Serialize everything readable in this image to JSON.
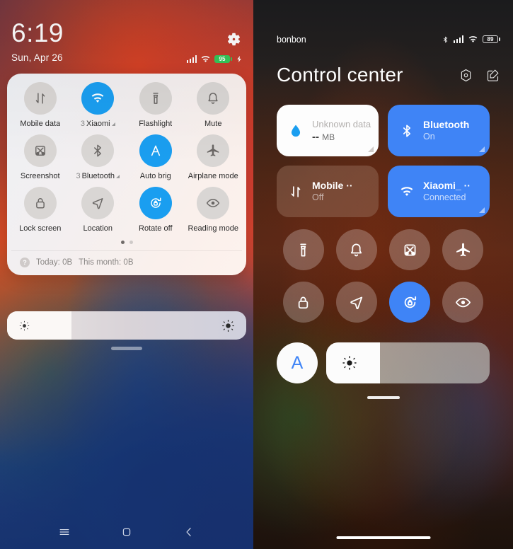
{
  "left": {
    "status": {
      "time": "6:19",
      "date": "Sun, Apr 26",
      "gear_icon": "gear-icon",
      "signal_icon": "signal-bars-icon",
      "wifi_icon": "wifi-icon",
      "battery_level": "95",
      "charging_icon": "charging-bolt-icon"
    },
    "quick_settings": {
      "tiles": [
        {
          "label": "Mobile data",
          "icon": "mobile-data-icon",
          "active": false,
          "badge": "",
          "has_arrow": false
        },
        {
          "label": "Xiaomi",
          "icon": "wifi-icon",
          "active": true,
          "badge": "3",
          "has_arrow": true
        },
        {
          "label": "Flashlight",
          "icon": "flashlight-icon",
          "active": false,
          "badge": "",
          "has_arrow": false
        },
        {
          "label": "Mute",
          "icon": "bell-icon",
          "active": false,
          "badge": "",
          "has_arrow": false
        },
        {
          "label": "Screenshot",
          "icon": "screenshot-icon",
          "active": false,
          "badge": "",
          "has_arrow": false
        },
        {
          "label": "Bluetooth",
          "icon": "bluetooth-icon",
          "active": false,
          "badge": "3",
          "has_arrow": true
        },
        {
          "label": "Auto brig",
          "icon": "auto-brightness-icon",
          "active": true,
          "badge": "",
          "has_arrow": false
        },
        {
          "label": "Airplane mode",
          "icon": "airplane-icon",
          "active": false,
          "badge": "",
          "has_arrow": false
        },
        {
          "label": "Lock screen",
          "icon": "lock-icon",
          "active": false,
          "badge": "",
          "has_arrow": false
        },
        {
          "label": "Location",
          "icon": "location-arrow-icon",
          "active": false,
          "badge": "",
          "has_arrow": false
        },
        {
          "label": "Rotate off",
          "icon": "rotate-lock-icon",
          "active": true,
          "badge": "",
          "has_arrow": false
        },
        {
          "label": "Reading mode",
          "icon": "eye-icon",
          "active": false,
          "badge": "",
          "has_arrow": false
        }
      ],
      "page_dots": 2,
      "active_page": 0,
      "footer": {
        "help_icon": "question-mark-icon",
        "today": "Today: 0B",
        "this_month": "This month: 0B"
      }
    },
    "brightness": {
      "low_icon": "brightness-low-icon",
      "high_icon": "brightness-high-icon",
      "fill_percent": 27
    },
    "navbar": {
      "recents_icon": "menu-recents-icon",
      "home_icon": "home-square-icon",
      "back_icon": "back-chevron-icon"
    }
  },
  "right": {
    "status": {
      "user": "bonbon",
      "bluetooth_icon": "bluetooth-icon",
      "signal_icon": "signal-bars-icon",
      "wifi_icon": "wifi-icon",
      "battery_level": "89"
    },
    "header": {
      "title": "Control center",
      "settings_icon": "settings-hexagon-icon",
      "edit_icon": "edit-pencil-icon"
    },
    "cards": [
      {
        "title": "Unknown data ··",
        "subtitle": "-- ",
        "unit": "MB",
        "icon": "data-drop-icon",
        "style": "white",
        "resizable": true
      },
      {
        "title": "Bluetooth",
        "subtitle": "On",
        "unit": "",
        "icon": "bluetooth-icon",
        "style": "blue",
        "resizable": true
      },
      {
        "title": "Mobile ··",
        "subtitle": "Off",
        "unit": "",
        "icon": "mobile-data-icon",
        "style": "dim",
        "resizable": false
      },
      {
        "title": "Xiaomi_ ··",
        "subtitle": "Connected",
        "unit": "",
        "icon": "wifi-icon",
        "style": "blue",
        "resizable": true
      }
    ],
    "toggles": [
      {
        "icon": "flashlight-icon",
        "active": false,
        "name": "flashlight"
      },
      {
        "icon": "bell-icon",
        "active": false,
        "name": "mute"
      },
      {
        "icon": "screenshot-icon",
        "active": false,
        "name": "screenshot"
      },
      {
        "icon": "airplane-icon",
        "active": false,
        "name": "airplane-mode"
      },
      {
        "icon": "lock-icon",
        "active": false,
        "name": "lock-screen"
      },
      {
        "icon": "location-arrow-icon",
        "active": false,
        "name": "location"
      },
      {
        "icon": "rotate-lock-icon",
        "active": true,
        "name": "rotate-off"
      },
      {
        "icon": "eye-icon",
        "active": false,
        "name": "reading-mode"
      }
    ],
    "brightness": {
      "auto_label": "A",
      "icon": "brightness-high-icon",
      "fill_percent": 33
    }
  },
  "colors": {
    "accent_blue_left": "#1a9ef0",
    "accent_blue_right": "#3f84f6",
    "battery_green": "#35c759"
  }
}
